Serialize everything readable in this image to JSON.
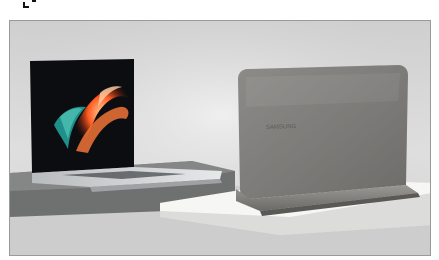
{
  "product_image": {
    "alt": "",
    "logo_text": "SAMSUNG",
    "colors": {
      "backdrop": "#d6d6d6",
      "floor": "#cfcfcf",
      "platform_left": "#6f7070",
      "platform_right": "#ececea",
      "laptop_silver": "#c9cbcc",
      "laptop_graphite": "#7d7c79",
      "screen_black": "#0b0d10",
      "accent_orange": "#ff5a1e",
      "accent_teal": "#1f8f8a"
    }
  }
}
